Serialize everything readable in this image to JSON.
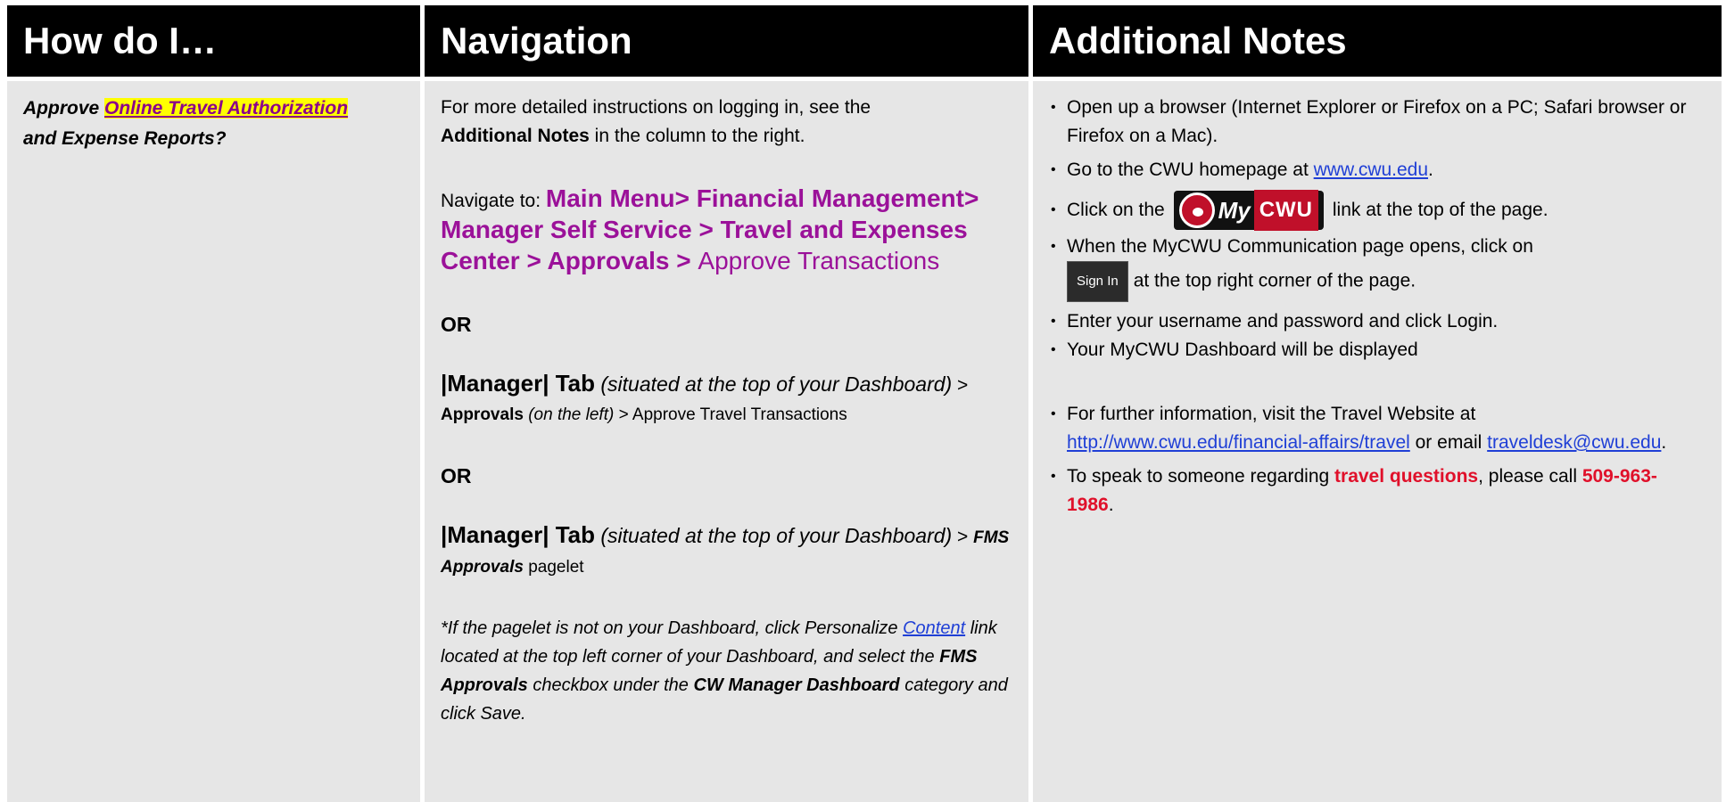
{
  "header": {
    "col1": "How do I…",
    "col2": "Navigation",
    "col3": "Additional Notes"
  },
  "col1": {
    "prefix": "Approve ",
    "highlight": "Online Travel Authorization",
    "suffix": "and Expense Reports?"
  },
  "col2": {
    "intro_a": "For more detailed instructions on logging in, see the",
    "intro_b_bold": "Additional Notes",
    "intro_b_rest": " in the column to the right.",
    "navigate_label": "Navigate to: ",
    "path_bold": "Main Menu> Financial Management> Manager Self Service > Travel and Expenses Center > Approvals > ",
    "path_tail": "Approve Transactions",
    "or1": "OR",
    "mgr1": "|Manager| Tab",
    "mgr1_it": " (situated at the top of your Dashboard)",
    "mgr1_sep": " > ",
    "approvals": "Approvals",
    "on_left": " (on the left)",
    "mgr1_tail": " > Approve Travel Transactions",
    "or2": "OR",
    "mgr2": "|Manager| Tab",
    "mgr2_it": " (situated at the top of your Dashboard)",
    "mgr2_sep": " > ",
    "fms": "FMS Approvals",
    "pagelet": " pagelet",
    "note_a": "*If the pagelet is not on your Dashboard, click Personalize ",
    "note_link": "Content",
    "note_b": " link located at the top left corner of your Dashboard, and select the ",
    "note_fms": "FMS Approvals",
    "note_c": " checkbox under the ",
    "note_cw": "CW Manager Dashboard",
    "note_d": " category and click Save."
  },
  "col3": {
    "b1": "Open up a browser (Internet Explorer or Firefox on a PC; Safari browser or Firefox on a Mac).",
    "b2_a": "Go to the CWU homepage at ",
    "b2_link": "www.cwu.edu",
    "b2_b": ".",
    "b3_a": "Click on the",
    "b3_b": "link at the top of the page.",
    "logo_my": "My",
    "logo_cwu": "CWU",
    "b4_a": "When the MyCWU Communication page opens, click on",
    "signin": "Sign In",
    "b4_b": "at the top right corner of the page.",
    "b5": "Enter your username and password and click Login.",
    "b6": "Your MyCWU Dashboard will be displayed",
    "b7_a": "For further information, visit the Travel Website at ",
    "b7_link1": "http://www.cwu.edu/financial-affairs/travel",
    "b7_b": " or email ",
    "b7_link2": "traveldesk@cwu.edu",
    "b7_c": ".",
    "b8_a": "To speak to someone regarding ",
    "b8_red": "travel questions",
    "b8_b": ", please call ",
    "b8_phone": "509-963-1986",
    "b8_c": "."
  }
}
